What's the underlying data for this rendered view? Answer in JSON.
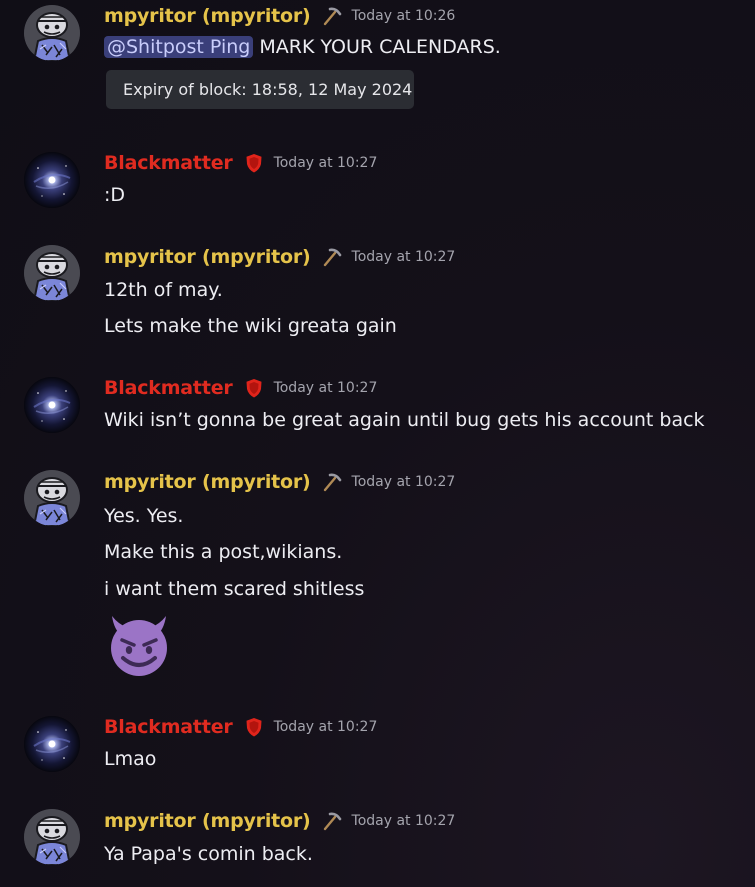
{
  "colors": {
    "mpyritor_name": "#e5c34a",
    "blackmatter_name": "#e02b20",
    "mention_bg": "#3a3f7a",
    "tooltip_bg": "#2b2d33"
  },
  "messages": [
    {
      "author": "mpyritor (mpyritor)",
      "badge": "pickaxe-icon",
      "time": "Today at 10:26",
      "mention": "@Shitpost Ping",
      "lines": [
        "MARK YOUR CALENDARS."
      ],
      "tooltip": "Expiry of block: 18:58, 12 May 2024"
    },
    {
      "author": "Blackmatter",
      "badge": "shield-icon",
      "time": "Today at 10:27",
      "lines": [
        ":D"
      ]
    },
    {
      "author": "mpyritor (mpyritor)",
      "badge": "pickaxe-icon",
      "time": "Today at 10:27",
      "lines": [
        "12th of may.",
        "Lets make the wiki greata gain"
      ]
    },
    {
      "author": "Blackmatter",
      "badge": "shield-icon",
      "time": "Today at 10:27",
      "lines": [
        "Wiki isn’t gonna be great again until bug gets his account back"
      ]
    },
    {
      "author": "mpyritor (mpyritor)",
      "badge": "pickaxe-icon",
      "time": "Today at 10:27",
      "lines": [
        "Yes. Yes.",
        "Make this a post,wikians.",
        "i want them scared shitless"
      ],
      "emoji": "smiling-imp-emoji"
    },
    {
      "author": "Blackmatter",
      "badge": "shield-icon",
      "time": "Today at 10:27",
      "lines": [
        "Lmao"
      ]
    },
    {
      "author": "mpyritor (mpyritor)",
      "badge": "pickaxe-icon",
      "time": "Today at 10:27",
      "lines": [
        "Ya Papa's comin back."
      ]
    }
  ]
}
